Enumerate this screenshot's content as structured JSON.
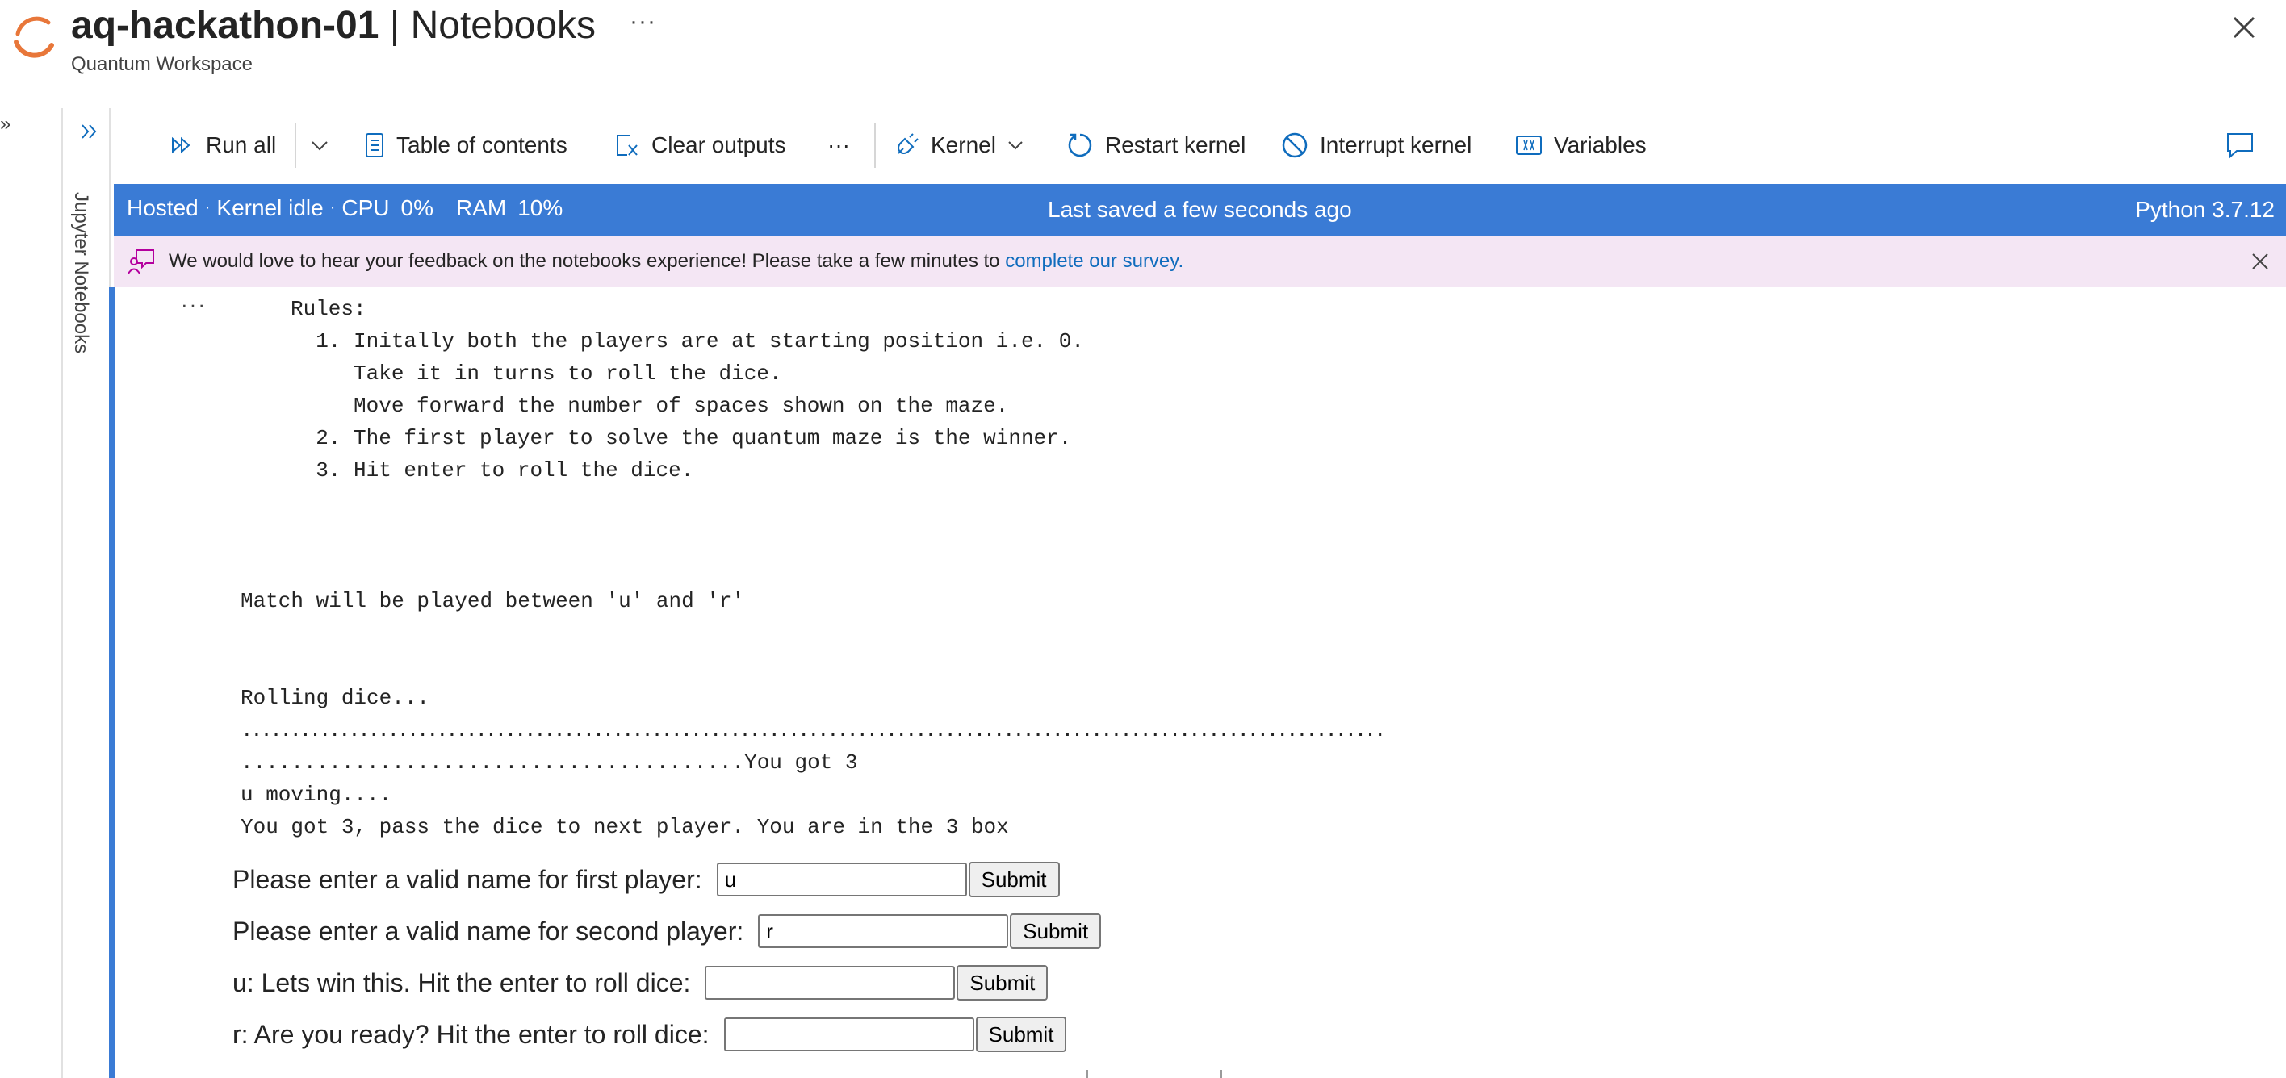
{
  "header": {
    "title_main": "aq-hackathon-01",
    "title_sep": "|",
    "title_section": "Notebooks",
    "subtitle": "Quantum Workspace",
    "more": "···"
  },
  "sidebar": {
    "rail_label": "Jupyter Notebooks"
  },
  "toolbar": {
    "run_all": "Run all",
    "table_of_contents": "Table of contents",
    "clear_outputs": "Clear outputs",
    "more": "···",
    "kernel": "Kernel",
    "restart_kernel": "Restart kernel",
    "interrupt_kernel": "Interrupt kernel",
    "variables": "Variables"
  },
  "status": {
    "hosted": "Hosted",
    "kernel_state": "Kernel idle",
    "cpu_label": "CPU",
    "cpu_value": "0%",
    "ram_label": "RAM",
    "ram_value": "10%",
    "saved": "Last saved a few seconds ago",
    "python": "Python 3.7.12"
  },
  "banner": {
    "text": "We would love to hear your feedback on the notebooks experience! Please take a few minutes to ",
    "link": "complete our survey."
  },
  "cell": {
    "more": "···",
    "rules_lines": [
      "Rules:",
      "  1. Initally both the players are at starting position i.e. 0.",
      "     Take it in turns to roll the dice.",
      "     Move forward the number of spaces shown on the maze.",
      "  2. The first player to solve the quantum maze is the winner.",
      "  3. Hit enter to roll the dice."
    ],
    "match_line": "Match will be played between 'u' and 'r'",
    "rolling_line": "Rolling dice...",
    "dots_line": ".....................................................................................................................",
    "dots_got_line": "........................................You got 3",
    "moving_line": "u moving....",
    "result_line": "You got 3, pass the dice to next player. You are in the 3 box"
  },
  "widgets": [
    {
      "label": "Please enter a valid name for first player:",
      "value": "u",
      "button": "Submit"
    },
    {
      "label": "Please enter a valid name for second player:",
      "value": "r",
      "button": "Submit"
    },
    {
      "label": "u: Lets win this. Hit the enter to roll dice:",
      "value": "",
      "button": "Submit"
    },
    {
      "label": "r: Are you ready? Hit the enter to roll dice:",
      "value": "",
      "button": "Submit"
    }
  ],
  "colors": {
    "accent": "#3a7bd5",
    "banner_bg": "#f4e6f4",
    "link": "#0f6cbd",
    "logo": "#e8773a"
  }
}
